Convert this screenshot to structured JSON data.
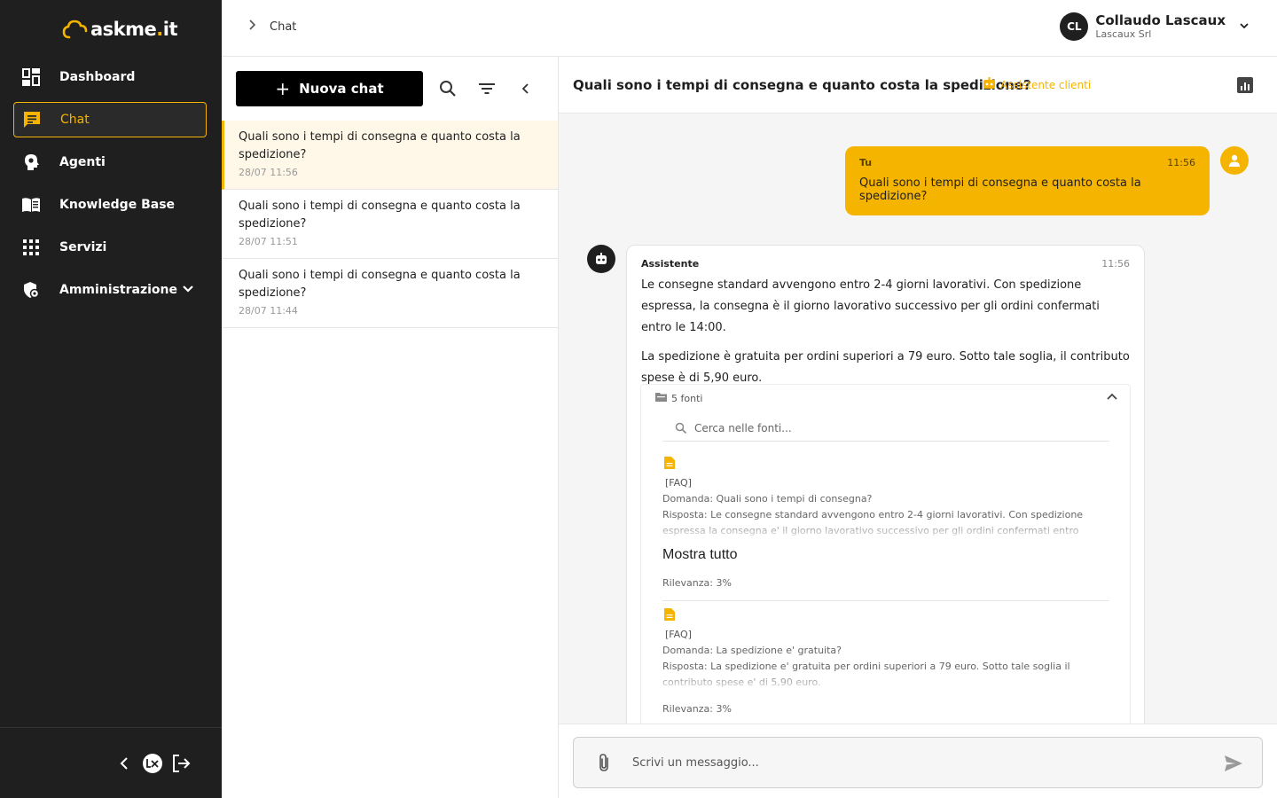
{
  "app": {
    "logo_main": "askme",
    "logo_dot": ".",
    "logo_tld": "it"
  },
  "sidebar": {
    "items": [
      {
        "label": "Dashboard",
        "icon": "dashboard-icon"
      },
      {
        "label": "Chat",
        "icon": "chat-icon",
        "active": true
      },
      {
        "label": "Agenti",
        "icon": "agent-head-icon"
      },
      {
        "label": "Knowledge Base",
        "icon": "book-icon"
      },
      {
        "label": "Servizi",
        "icon": "grid-icon"
      },
      {
        "label": "Amministrazione",
        "icon": "admin-shield-icon"
      }
    ]
  },
  "topbar": {
    "breadcrumb": "Chat",
    "user": {
      "initials": "CL",
      "name": "Collaudo Lascaux",
      "org": "Lascaux Srl"
    }
  },
  "chat_list": {
    "new_chat_label": "Nuova chat",
    "conversations": [
      {
        "title": "Quali sono i tempi di consegna e quanto costa la spedizione?",
        "date": "28/07 11:56"
      },
      {
        "title": "Quali sono i tempi di consegna e quanto costa la spedizione?",
        "date": "28/07 11:51"
      },
      {
        "title": "Quali sono i tempi di consegna e quanto costa la spedizione?",
        "date": "28/07 11:44"
      }
    ]
  },
  "chat": {
    "title": "Quali sono i tempi di consegna e quanto costa la spedizione?",
    "agent": "Assistente clienti",
    "user_message": {
      "author": "Tu",
      "time": "11:56",
      "text": "Quali sono i tempi di consegna e quanto costa la spedizione?"
    },
    "bot_message": {
      "author": "Assistente",
      "time": "11:56",
      "p1": "Le consegne standard avvengono entro 2-4 giorni lavorativi. Con spedizione espressa, la consegna è il giorno lavorativo successivo per gli ordini confermati entro le 14:00.",
      "p2": "La spedizione è gratuita per ordini superiori a 79 euro. Sotto tale soglia, il contributo spese è di 5,90 euro."
    },
    "sources": {
      "count_label": "5 fonti",
      "search_placeholder": "Cerca nelle fonti...",
      "show_all_label": "Mostra tutto",
      "items": [
        {
          "tag": "[FAQ]",
          "question": "Domanda: Quali sono i tempi di consegna?",
          "answer": "Risposta: Le consegne standard avvengono entro 2-4 giorni lavorativi. Con spedizione espressa la consegna e' il giorno lavorativo successivo per gli ordini confermati entro",
          "relevance": "Rilevanza: 3%"
        },
        {
          "tag": "[FAQ]",
          "question": "Domanda: La spedizione e' gratuita?",
          "answer": "Risposta: La spedizione e' gratuita per ordini superiori a 79 euro. Sotto tale soglia il contributo spese e' di 5,90 euro.",
          "relevance": "Rilevanza: 3%"
        }
      ]
    },
    "composer_placeholder": "Scrivi un messaggio..."
  },
  "colors": {
    "accent": "#f5b400",
    "sidebar_bg": "#1f1f1f",
    "chat_bg": "#f5f5f5"
  }
}
